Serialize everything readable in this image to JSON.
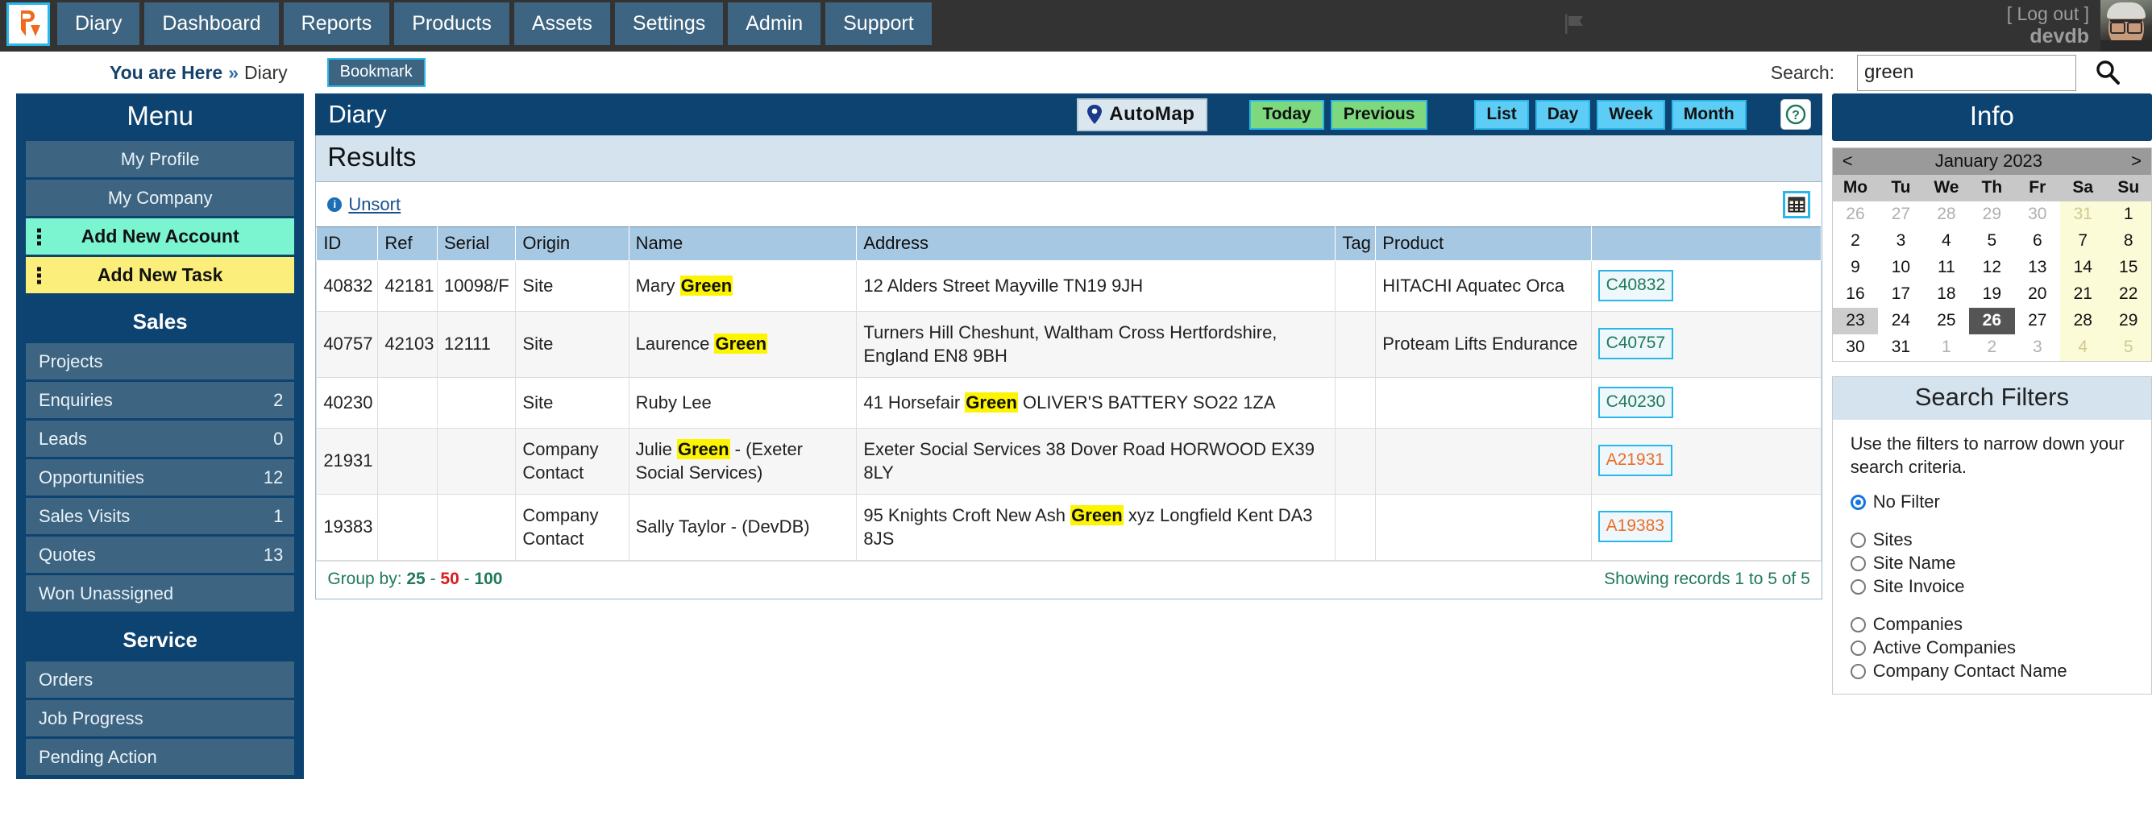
{
  "topnav": {
    "logo_name": "av-logo",
    "items": [
      "Diary",
      "Dashboard",
      "Reports",
      "Products",
      "Assets",
      "Settings",
      "Admin",
      "Support"
    ],
    "flag_icon": "flag-icon",
    "logout_label": "[ Log out ]",
    "username": "devdb"
  },
  "breadcrumb": {
    "here_label": "You are Here",
    "separator": "»",
    "page": "Diary",
    "bookmark_label": "Bookmark"
  },
  "search": {
    "label": "Search:",
    "value": "green",
    "placeholder": "",
    "icon": "search-icon"
  },
  "menu": {
    "title": "Menu",
    "top_items": [
      {
        "label": "My Profile"
      },
      {
        "label": "My Company"
      }
    ],
    "action_items": [
      {
        "label": "Add New Account",
        "color": "#7bf5d0"
      },
      {
        "label": "Add New Task",
        "color": "#fbee7b"
      }
    ],
    "sections": [
      {
        "title": "Sales",
        "items": [
          {
            "label": "Projects",
            "count": ""
          },
          {
            "label": "Enquiries",
            "count": "2"
          },
          {
            "label": "Leads",
            "count": "0"
          },
          {
            "label": "Opportunities",
            "count": "12"
          },
          {
            "label": "Sales Visits",
            "count": "1"
          },
          {
            "label": "Quotes",
            "count": "13"
          },
          {
            "label": "Won Unassigned",
            "count": ""
          }
        ]
      },
      {
        "title": "Service",
        "items": [
          {
            "label": "Orders",
            "count": ""
          },
          {
            "label": "Job Progress",
            "count": ""
          },
          {
            "label": "Pending Action",
            "count": ""
          }
        ]
      }
    ]
  },
  "diary": {
    "title": "Diary",
    "automap_label": "AutoMap",
    "automap_icon": "map-pin-icon",
    "buttons_green": [
      "Today",
      "Previous"
    ],
    "buttons_blue": [
      "List",
      "Day",
      "Week",
      "Month"
    ],
    "help_icon": "help-question-icon"
  },
  "results": {
    "heading": "Results",
    "unsort_label": "Unsort",
    "info_icon": "info-icon",
    "grid_icon": "grid-table-icon",
    "columns": [
      "ID",
      "Ref",
      "Serial",
      "Origin",
      "Name",
      "Address",
      "Tag",
      "Product",
      ""
    ],
    "rows": [
      {
        "id": "40832",
        "ref": "42181",
        "serial": "10098/F",
        "origin": "Site",
        "origin_type": "site",
        "name_pre": "Mary ",
        "name_hl": "Green",
        "name_post": "",
        "addr_pre": "12 Alders Street Mayville TN19 9JH",
        "addr_hl": "",
        "addr_post": "",
        "tag": "",
        "product": "HITACHI Aquatec Orca",
        "action": "C40832",
        "action_type": "green"
      },
      {
        "id": "40757",
        "ref": "42103",
        "serial": "12111",
        "origin": "Site",
        "origin_type": "site",
        "name_pre": "Laurence ",
        "name_hl": "Green",
        "name_post": "",
        "addr_pre": "Turners Hill Cheshunt, Waltham Cross Hertfordshire, England EN8 9BH",
        "addr_hl": "",
        "addr_post": "",
        "tag": "",
        "product": "Proteam Lifts Endurance",
        "action": "C40757",
        "action_type": "green"
      },
      {
        "id": "40230",
        "ref": "",
        "serial": "",
        "origin": "Site",
        "origin_type": "site",
        "name_pre": "Ruby Lee",
        "name_hl": "",
        "name_post": "",
        "addr_pre": "41 Horsefair ",
        "addr_hl": "Green",
        "addr_post": " OLIVER'S BATTERY SO22 1ZA",
        "tag": "",
        "product": "",
        "action": "C40230",
        "action_type": "green"
      },
      {
        "id": "21931",
        "ref": "",
        "serial": "",
        "origin": "Company Contact",
        "origin_type": "company",
        "name_pre": "Julie ",
        "name_hl": "Green",
        "name_post": " - (Exeter Social Services)",
        "addr_pre": "Exeter Social Services 38 Dover Road HORWOOD EX39 8LY",
        "addr_hl": "",
        "addr_post": "",
        "tag": "",
        "product": "",
        "action": "A21931",
        "action_type": "orange"
      },
      {
        "id": "19383",
        "ref": "",
        "serial": "",
        "origin": "Company Contact",
        "origin_type": "company",
        "name_pre": "Sally Taylor - (DevDB)",
        "name_hl": "",
        "name_post": "",
        "addr_pre": "95 Knights Croft New Ash ",
        "addr_hl": "Green",
        "addr_post": " xyz Longfield Kent DA3 8JS",
        "tag": "",
        "product": "",
        "action": "A19383",
        "action_type": "orange"
      }
    ],
    "footer": {
      "group_by_label": "Group by:",
      "group_options": [
        "25",
        "50",
        "100"
      ],
      "group_active": "50",
      "showing": "Showing records 1 to 5 of 5"
    }
  },
  "info": {
    "title": "Info",
    "calendar": {
      "prev": "<",
      "next": ">",
      "month_label": "January 2023",
      "daynames": [
        "Mo",
        "Tu",
        "We",
        "Th",
        "Fr",
        "Sa",
        "Su"
      ],
      "weeks": [
        [
          {
            "d": "26",
            "m": 1,
            "w": 0
          },
          {
            "d": "27",
            "m": 1,
            "w": 0
          },
          {
            "d": "28",
            "m": 1,
            "w": 0
          },
          {
            "d": "29",
            "m": 1,
            "w": 0
          },
          {
            "d": "30",
            "m": 1,
            "w": 0
          },
          {
            "d": "31",
            "m": 1,
            "w": 1
          },
          {
            "d": "1",
            "m": 0,
            "w": 1
          }
        ],
        [
          {
            "d": "2",
            "m": 0,
            "w": 0
          },
          {
            "d": "3",
            "m": 0,
            "w": 0
          },
          {
            "d": "4",
            "m": 0,
            "w": 0
          },
          {
            "d": "5",
            "m": 0,
            "w": 0
          },
          {
            "d": "6",
            "m": 0,
            "w": 0
          },
          {
            "d": "7",
            "m": 0,
            "w": 1
          },
          {
            "d": "8",
            "m": 0,
            "w": 1
          }
        ],
        [
          {
            "d": "9",
            "m": 0,
            "w": 0
          },
          {
            "d": "10",
            "m": 0,
            "w": 0
          },
          {
            "d": "11",
            "m": 0,
            "w": 0
          },
          {
            "d": "12",
            "m": 0,
            "w": 0
          },
          {
            "d": "13",
            "m": 0,
            "w": 0
          },
          {
            "d": "14",
            "m": 0,
            "w": 1
          },
          {
            "d": "15",
            "m": 0,
            "w": 1
          }
        ],
        [
          {
            "d": "16",
            "m": 0,
            "w": 0
          },
          {
            "d": "17",
            "m": 0,
            "w": 0
          },
          {
            "d": "18",
            "m": 0,
            "w": 0
          },
          {
            "d": "19",
            "m": 0,
            "w": 0
          },
          {
            "d": "20",
            "m": 0,
            "w": 0
          },
          {
            "d": "21",
            "m": 0,
            "w": 1
          },
          {
            "d": "22",
            "m": 0,
            "w": 1
          }
        ],
        [
          {
            "d": "23",
            "m": 0,
            "w": 0,
            "sel": 1
          },
          {
            "d": "24",
            "m": 0,
            "w": 0
          },
          {
            "d": "25",
            "m": 0,
            "w": 0
          },
          {
            "d": "26",
            "m": 0,
            "w": 0,
            "today": 1
          },
          {
            "d": "27",
            "m": 0,
            "w": 0
          },
          {
            "d": "28",
            "m": 0,
            "w": 1
          },
          {
            "d": "29",
            "m": 0,
            "w": 1
          }
        ],
        [
          {
            "d": "30",
            "m": 0,
            "w": 0
          },
          {
            "d": "31",
            "m": 0,
            "w": 0
          },
          {
            "d": "1",
            "m": 1,
            "w": 0
          },
          {
            "d": "2",
            "m": 1,
            "w": 0
          },
          {
            "d": "3",
            "m": 1,
            "w": 0
          },
          {
            "d": "4",
            "m": 1,
            "w": 1
          },
          {
            "d": "5",
            "m": 1,
            "w": 1
          }
        ]
      ]
    },
    "filters": {
      "title": "Search Filters",
      "description": "Use the filters to narrow down your search criteria.",
      "groups": [
        [
          {
            "label": "No Filter",
            "selected": true
          }
        ],
        [
          {
            "label": "Sites",
            "selected": false
          },
          {
            "label": "Site Name",
            "selected": false
          },
          {
            "label": "Site Invoice",
            "selected": false
          }
        ],
        [
          {
            "label": "Companies",
            "selected": false
          },
          {
            "label": "Active Companies",
            "selected": false
          },
          {
            "label": "Company Contact Name",
            "selected": false
          }
        ]
      ]
    }
  },
  "colors": {
    "brand_dark": "#0d4370",
    "nav_bg": "#333333",
    "nav_item": "#3d6480",
    "accent_cyan": "#29b6e8",
    "green_btn": "#7ed97e",
    "blue_btn": "#5ecdf5",
    "highlight": "#fdf400",
    "site_green": "#1f7a57",
    "company_orange": "#ef6c22"
  }
}
